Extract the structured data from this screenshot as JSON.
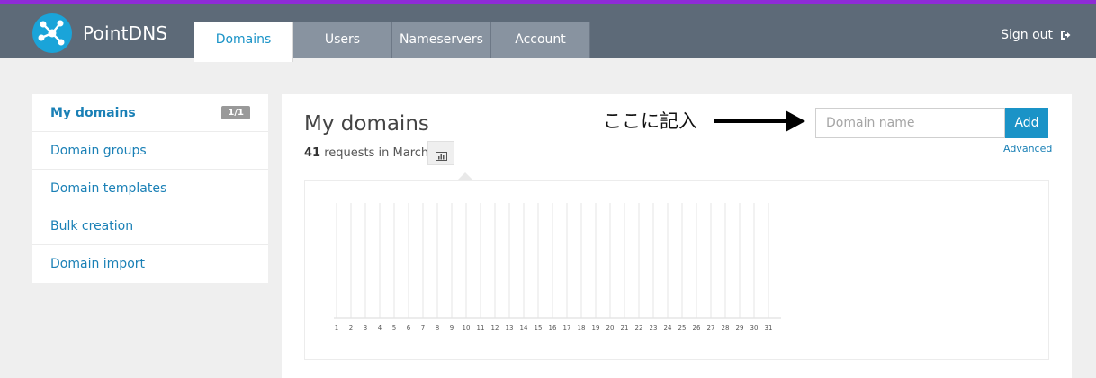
{
  "brand": {
    "name": "PointDNS"
  },
  "header": {
    "tabs": [
      {
        "label": "Domains",
        "active": true
      },
      {
        "label": "Users",
        "active": false
      },
      {
        "label": "Nameservers",
        "active": false
      },
      {
        "label": "Account",
        "active": false
      }
    ],
    "signout_label": "Sign out"
  },
  "sidebar": {
    "items": [
      {
        "label": "My domains",
        "badge": "1/1",
        "active": true
      },
      {
        "label": "Domain groups"
      },
      {
        "label": "Domain templates"
      },
      {
        "label": "Bulk creation"
      },
      {
        "label": "Domain import"
      }
    ]
  },
  "main": {
    "title": "My domains",
    "requests_count": "41",
    "requests_suffix": "requests in March",
    "annotation": "ここに記入",
    "search": {
      "placeholder": "Domain name",
      "value": ""
    },
    "add_label": "Add",
    "advanced_label": "Advanced"
  },
  "chart_data": {
    "type": "bar",
    "categories": [
      "1",
      "2",
      "3",
      "4",
      "5",
      "6",
      "7",
      "8",
      "9",
      "10",
      "11",
      "12",
      "13",
      "14",
      "15",
      "16",
      "17",
      "18",
      "19",
      "20",
      "21",
      "22",
      "23",
      "24",
      "25",
      "26",
      "27",
      "28",
      "29",
      "30",
      "31"
    ],
    "values": [
      0,
      0,
      0,
      0,
      0,
      0,
      0,
      0,
      0,
      0,
      0,
      0,
      0,
      0,
      0,
      0,
      0,
      0,
      0,
      0,
      0,
      0,
      0,
      0,
      0,
      0,
      0,
      0,
      0,
      0,
      0
    ],
    "title": "",
    "xlabel": "",
    "ylabel": "",
    "grid": true
  },
  "colors": {
    "accent": "#1a93c7",
    "topbar": "#5d6a78",
    "top_border": "#8e2bd6",
    "link": "#1a80b6"
  }
}
